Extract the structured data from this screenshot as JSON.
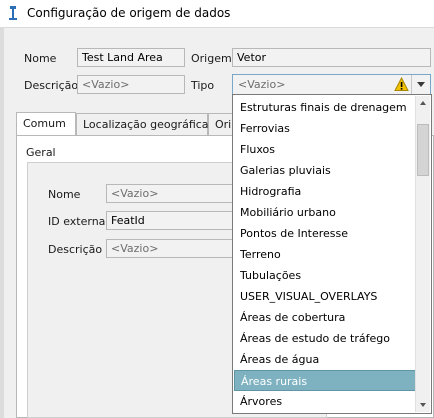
{
  "window": {
    "title": "Configuração de origem de dados"
  },
  "form": {
    "nome_label": "Nome",
    "nome_value": "Test Land Area",
    "origem_label": "Origem",
    "origem_value": "Vetor",
    "descricao_label": "Descrição",
    "descricao_value": "<Vazio>",
    "tipo_label": "Tipo",
    "tipo_value": "<Vazio>"
  },
  "tabs": [
    {
      "label": "Comum",
      "active": true
    },
    {
      "label": "Localização geográfica",
      "active": false
    },
    {
      "label": "Ori",
      "active": false
    }
  ],
  "geral": {
    "title": "Geral",
    "nome_label": "Nome",
    "nome_value": "<Vazio>",
    "id_label": "ID externa",
    "id_value": "FeatId",
    "descricao_label": "Descrição",
    "descricao_value": "<Vazio>"
  },
  "dropdown": {
    "items": [
      "Estruturas finais de drenagem",
      "Ferrovias",
      "Fluxos",
      "Galerias pluviais",
      "Hidrografia",
      "Mobiliário urbano",
      "Pontos de Interesse",
      "Terreno",
      "Tubulações",
      "USER_VISUAL_OVERLAYS",
      "Áreas de cobertura",
      "Áreas de estudo de tráfego",
      "Áreas de água",
      "Áreas rurais",
      "Árvores"
    ],
    "selected_index": 13
  },
  "colors": {
    "selection": "#7fb2c1",
    "warning": "#f2c200"
  },
  "icons": {
    "app": "app-icon",
    "warning": "warning-icon",
    "arrow": "chevron-down-icon"
  }
}
